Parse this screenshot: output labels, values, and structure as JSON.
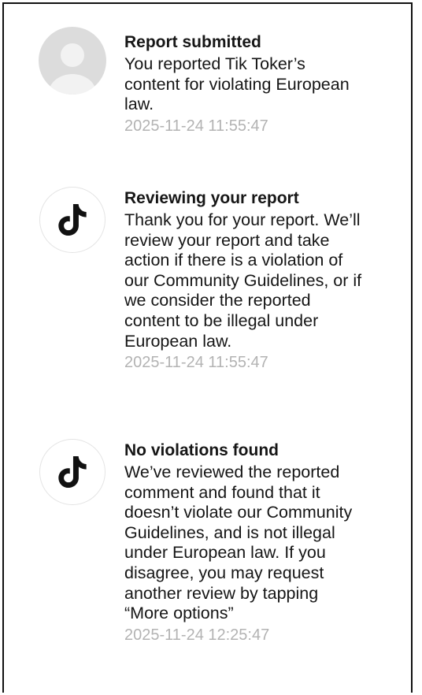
{
  "notifications": [
    {
      "icon": "default-avatar-icon",
      "title": "Report submitted",
      "body": "You reported Tik Toker’s\ncontent for violating European\nlaw.",
      "timestamp": "2025-11-24 11:55:47"
    },
    {
      "icon": "tiktok-logo-icon",
      "title": "Reviewing your report",
      "body": "Thank you for your report. We’ll\nreview your report and take\naction if there is a violation of\nour Community Guidelines, or if\nwe consider the reported\ncontent to be illegal under\nEuropean law.",
      "timestamp": "2025-11-24 11:55:47"
    },
    {
      "icon": "tiktok-logo-icon",
      "title": "No violations found",
      "body": "We’ve reviewed the reported\ncomment and found that it\ndoesn’t violate our Community\nGuidelines, and is not illegal\nunder European law. If you\ndisagree, you may request\nanother review by tapping\n“More options”",
      "timestamp": "2025-11-24 12:25:47"
    }
  ],
  "colors": {
    "text": "#161616",
    "timestamp": "#b3b3b3",
    "avatar_placeholder": "#dcdcdc",
    "avatar_silhouette": "#f2f2f2",
    "tiktok_logo": "#111111"
  }
}
